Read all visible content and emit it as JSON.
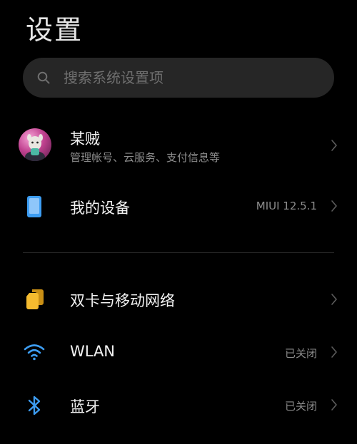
{
  "page": {
    "title": "设置"
  },
  "search": {
    "placeholder": "搜索系统设置项"
  },
  "account": {
    "name": "某贼",
    "subtitle": "管理帐号、云服务、支付信息等"
  },
  "device": {
    "label": "我的设备",
    "value": "MIUI 12.5.1"
  },
  "network": {
    "label": "双卡与移动网络"
  },
  "wlan": {
    "label": "WLAN",
    "status": "已关闭"
  },
  "bluetooth": {
    "label": "蓝牙",
    "status": "已关闭"
  },
  "icons": {
    "search": "search-icon",
    "chevron": "chevron-right-icon",
    "device": "phone-icon",
    "sim": "sim-card-icon",
    "wifi": "wifi-icon",
    "bluetooth": "bluetooth-icon"
  },
  "colors": {
    "background": "#000000",
    "search_bg": "#262626",
    "accent_blue": "#3d9df2",
    "sim_yellow": "#f5bb2f",
    "secondary_text": "#8c8c8c"
  }
}
